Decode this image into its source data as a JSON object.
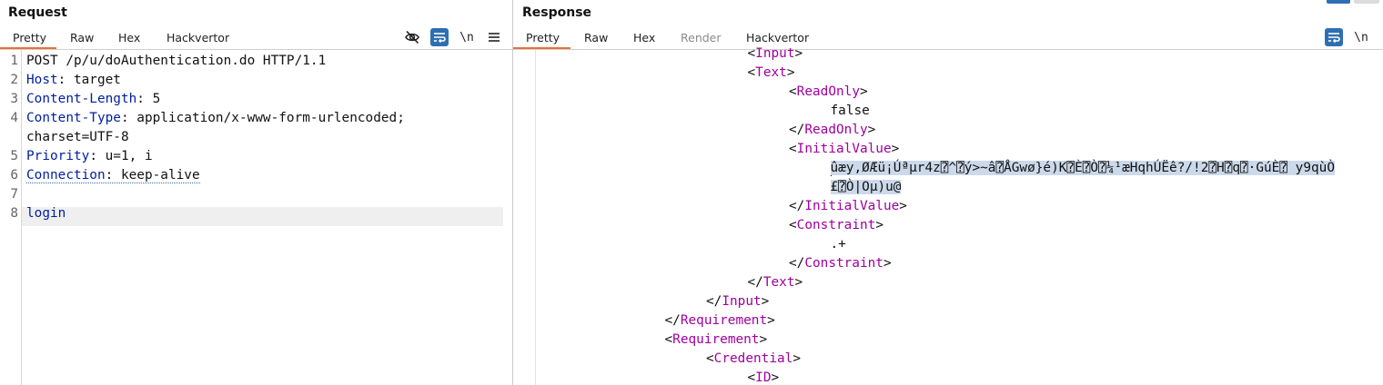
{
  "request": {
    "title": "Request",
    "tabs": [
      "Pretty",
      "Raw",
      "Hex",
      "Hackvertor"
    ],
    "active_tab": "Pretty",
    "toolbar": {
      "newline_label": "\\n"
    },
    "lines": [
      {
        "num": "1",
        "name": "",
        "value": "POST /p/u/doAuthentication.do HTTP/1.1"
      },
      {
        "num": "2",
        "name": "Host",
        "value": "target"
      },
      {
        "num": "3",
        "name": "Content-Length",
        "value": "5"
      },
      {
        "num": "4",
        "name": "Content-Type",
        "value": "application/x-www-form-urlencoded;"
      },
      {
        "num": "",
        "name": "",
        "value": "charset=UTF-8"
      },
      {
        "num": "5",
        "name": "Priority",
        "value": "u=1, i"
      },
      {
        "num": "6",
        "name": "Connection",
        "value": "keep-alive"
      },
      {
        "num": "7",
        "name": "",
        "value": ""
      },
      {
        "num": "8",
        "name": "",
        "value": "login"
      }
    ]
  },
  "response": {
    "title": "Response",
    "tabs": [
      "Pretty",
      "Raw",
      "Hex",
      "Render",
      "Hackvertor"
    ],
    "active_tab": "Pretty",
    "disabled_tab": "Render",
    "toolbar": {
      "newline_label": "\\n"
    },
    "lines": [
      {
        "indent": 5,
        "tag": "Input",
        "close": false,
        "partial": true
      },
      {
        "indent": 5,
        "tag": "Text",
        "close": false
      },
      {
        "indent": 6,
        "tag": "ReadOnly",
        "close": false
      },
      {
        "indent": 7,
        "text": "false"
      },
      {
        "indent": 6,
        "tag": "ReadOnly",
        "close": true
      },
      {
        "indent": 6,
        "tag": "InitialValue",
        "close": false
      },
      {
        "indent": 7,
        "text": "ûæy,ØÆü¡Úªµr4z⍰^⍰ý>~â⍰ÅGwø}é)K⍰È⍰Ò⍰¼¹æHqhÚËê?/!2⍰H⍰q⍰·GúÈ⍰ y9qùÒ",
        "selected": true,
        "caret": true
      },
      {
        "indent": 7,
        "text": "£⍰Ò|Oµ)u@",
        "selected": true
      },
      {
        "indent": 6,
        "tag": "InitialValue",
        "close": true
      },
      {
        "indent": 6,
        "tag": "Constraint",
        "close": false
      },
      {
        "indent": 7,
        "text": ".+"
      },
      {
        "indent": 6,
        "tag": "Constraint",
        "close": true
      },
      {
        "indent": 5,
        "tag": "Text",
        "close": true
      },
      {
        "indent": 4,
        "tag": "Input",
        "close": true
      },
      {
        "indent": 3,
        "tag": "Requirement",
        "close": true
      },
      {
        "indent": 3,
        "tag": "Requirement",
        "close": false
      },
      {
        "indent": 4,
        "tag": "Credential",
        "close": false
      },
      {
        "indent": 5,
        "tag": "ID",
        "close": false
      }
    ]
  },
  "colors": {
    "accent": "#e8703a",
    "header_name": "#001fa0",
    "xml_tag": "#a000a0",
    "selection": "#cbd9ea",
    "active_tool": "#2e6fb3"
  },
  "icons": [
    "eye-off-icon",
    "wrap-icon",
    "newline-icon",
    "menu-icon"
  ]
}
